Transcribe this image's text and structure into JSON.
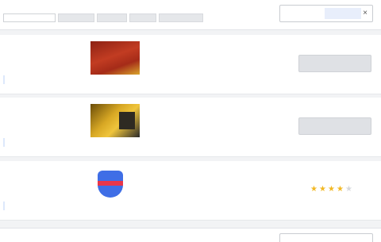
{
  "header": {
    "title": "",
    "tabs": [
      {
        "label": "",
        "active": true
      },
      {
        "label": "",
        "active": false
      },
      {
        "label": "",
        "active": false
      },
      {
        "label": "",
        "active": false
      },
      {
        "label": "",
        "active": false
      }
    ],
    "search_placeholder": "",
    "search_button": "",
    "close_icon": "×"
  },
  "items": [
    {
      "seller": {
        "name": "",
        "lines": [
          "",
          ""
        ],
        "link": ""
      },
      "thumbnail": "product-image-red",
      "description": {
        "lines": [
          "",
          ""
        ],
        "link": ""
      },
      "price": "",
      "action_label": ""
    },
    {
      "seller": {
        "name": "",
        "lines": [
          "",
          ""
        ],
        "link": ""
      },
      "thumbnail": "product-image-gold",
      "description": {
        "lines": [
          "",
          ""
        ],
        "link": ""
      },
      "price": "",
      "action_label": ""
    },
    {
      "seller": {
        "name": "",
        "lines": [
          "",
          ""
        ],
        "link": ""
      },
      "thumbnail": "shield-logo",
      "description": {
        "lines": [
          "",
          ""
        ],
        "link": ""
      },
      "rating_label": "",
      "rating": {
        "filled": 4,
        "total": 5
      }
    }
  ],
  "footer": {
    "title": "",
    "search_placeholder": ""
  },
  "colors": {
    "accent": "#2f6fd6",
    "star": "#f2b824",
    "shield": "#3f6ee6",
    "shield_band": "#e8364a"
  }
}
